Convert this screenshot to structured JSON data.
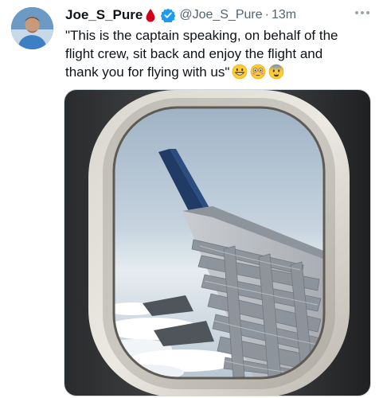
{
  "tweet": {
    "author": {
      "display_name": "Joe_S_Pure",
      "handle": "@Joe_S_Pure",
      "avatar_icon": "avatar-man-blue-shirt",
      "name_badge_icon": "blood-drop-icon",
      "verified_icon": "verified-badge-icon",
      "verified_color": "#1d9bf0"
    },
    "separator": "·",
    "time_ago": "13m",
    "more_icon": "more-horizontal-icon",
    "text_lines": [
      "\"This is the captain speaking, on behalf of the",
      "flight crew, sit back and enjoy the flight and",
      "thank you for flying with us\""
    ],
    "emojis": [
      "grinning-face-emoji",
      "flushed-face-emoji",
      "fearful-face-emoji"
    ],
    "media": {
      "kind": "photo",
      "subject": "airplane-window-wing-duct-tape-image"
    }
  },
  "colors": {
    "text_primary": "#0f1419",
    "text_secondary": "#536471",
    "accent": "#1d9bf0",
    "blood_drop": "#d0021b"
  }
}
